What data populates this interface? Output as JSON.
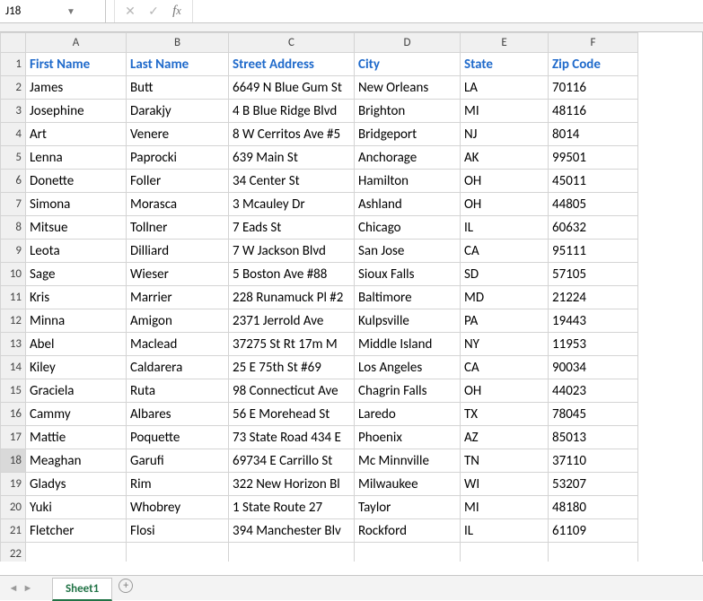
{
  "formula_bar": {
    "name_box": "J18",
    "formula_value": ""
  },
  "active_row_header": 18,
  "columns": [
    "A",
    "B",
    "C",
    "D",
    "E",
    "F"
  ],
  "header_row": [
    "First Name",
    "Last Name",
    "Street Address",
    "City",
    "State",
    "Zip Code"
  ],
  "rows": [
    {
      "n": 2,
      "cells": [
        "James",
        "Butt",
        "6649 N Blue Gum St",
        "New Orleans",
        "LA",
        "70116"
      ]
    },
    {
      "n": 3,
      "cells": [
        "Josephine",
        "Darakjy",
        "4 B Blue Ridge Blvd",
        "Brighton",
        "MI",
        "48116"
      ]
    },
    {
      "n": 4,
      "cells": [
        "Art",
        "Venere",
        "8 W Cerritos Ave #5",
        "Bridgeport",
        "NJ",
        "8014"
      ]
    },
    {
      "n": 5,
      "cells": [
        "Lenna",
        "Paprocki",
        "639 Main St",
        "Anchorage",
        "AK",
        "99501"
      ]
    },
    {
      "n": 6,
      "cells": [
        "Donette",
        "Foller",
        "34 Center St",
        "Hamilton",
        "OH",
        "45011"
      ]
    },
    {
      "n": 7,
      "cells": [
        "Simona",
        "Morasca",
        "3 Mcauley Dr",
        "Ashland",
        "OH",
        "44805"
      ]
    },
    {
      "n": 8,
      "cells": [
        "Mitsue",
        "Tollner",
        "7 Eads St",
        "Chicago",
        "IL",
        "60632"
      ]
    },
    {
      "n": 9,
      "cells": [
        "Leota",
        "Dilliard",
        "7 W Jackson Blvd",
        "San Jose",
        "CA",
        "95111"
      ]
    },
    {
      "n": 10,
      "cells": [
        "Sage",
        "Wieser",
        "5 Boston Ave #88",
        "Sioux Falls",
        "SD",
        "57105"
      ]
    },
    {
      "n": 11,
      "cells": [
        "Kris",
        "Marrier",
        "228 Runamuck Pl #2",
        "Baltimore",
        "MD",
        "21224"
      ]
    },
    {
      "n": 12,
      "cells": [
        "Minna",
        "Amigon",
        "2371 Jerrold Ave",
        "Kulpsville",
        "PA",
        "19443"
      ]
    },
    {
      "n": 13,
      "cells": [
        "Abel",
        "Maclead",
        "37275 St  Rt 17m M",
        "Middle Island",
        "NY",
        "11953"
      ]
    },
    {
      "n": 14,
      "cells": [
        "Kiley",
        "Caldarera",
        "25 E 75th St #69",
        "Los Angeles",
        "CA",
        "90034"
      ]
    },
    {
      "n": 15,
      "cells": [
        "Graciela",
        "Ruta",
        "98 Connecticut Ave",
        "Chagrin Falls",
        "OH",
        "44023"
      ]
    },
    {
      "n": 16,
      "cells": [
        "Cammy",
        "Albares",
        "56 E Morehead St",
        "Laredo",
        "TX",
        "78045"
      ]
    },
    {
      "n": 17,
      "cells": [
        "Mattie",
        "Poquette",
        "73 State Road 434 E",
        "Phoenix",
        "AZ",
        "85013"
      ]
    },
    {
      "n": 18,
      "cells": [
        "Meaghan",
        "Garufi",
        "69734 E Carrillo St",
        "Mc Minnville",
        "TN",
        "37110"
      ]
    },
    {
      "n": 19,
      "cells": [
        "Gladys",
        "Rim",
        "322 New Horizon Bl",
        "Milwaukee",
        "WI",
        "53207"
      ]
    },
    {
      "n": 20,
      "cells": [
        "Yuki",
        "Whobrey",
        "1 State Route 27",
        "Taylor",
        "MI",
        "48180"
      ]
    },
    {
      "n": 21,
      "cells": [
        "Fletcher",
        "Flosi",
        "394 Manchester Blv",
        "Rockford",
        "IL",
        "61109"
      ]
    }
  ],
  "extra_empty_rows": [
    22
  ],
  "sheet_tabs": {
    "active": "Sheet1"
  }
}
